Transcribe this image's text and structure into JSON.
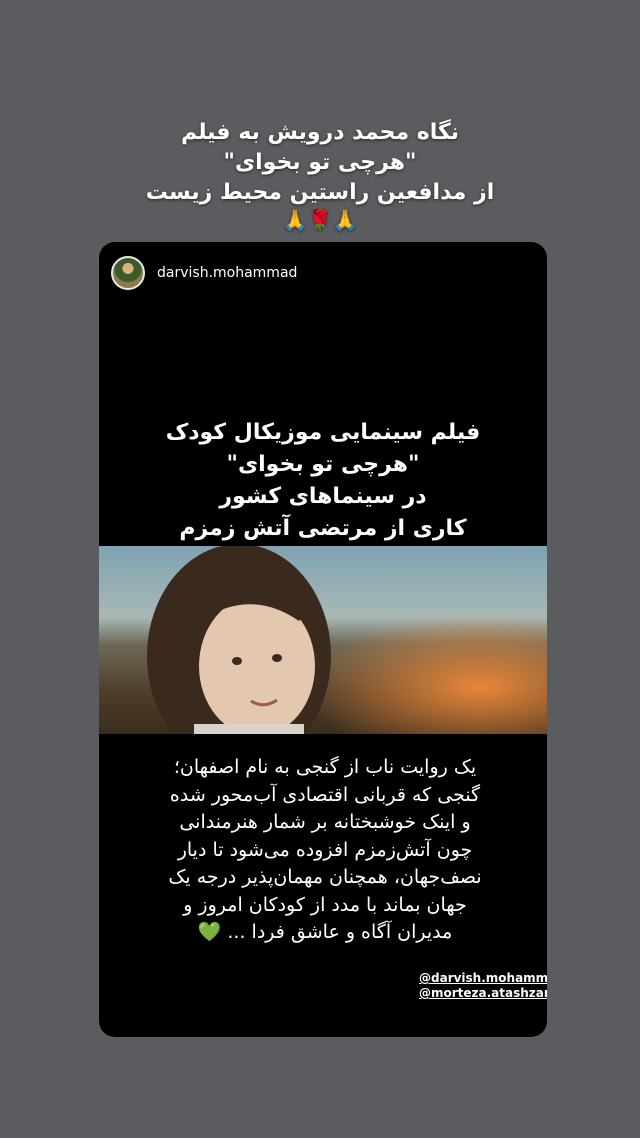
{
  "caption": {
    "lines": [
      "نگاه محمد درویش  به فیلم",
      "\"هرچی تو بخوای\"",
      "از مدافعین راستین محیط زیست"
    ],
    "emoji": "🙏🌹🙏"
  },
  "post": {
    "username": "darvish.mohammad",
    "title_lines": [
      "فیلم سینمایی موزیکال کودک",
      "\"هرچی تو بخوای\"",
      "در سینماهای کشور",
      "کاری از مرتضی آتش زمزم"
    ],
    "body_lines": [
      "یک روایت ناب از گنجی به نام اصفهان؛",
      "گنجی که قربانی اقتصادی آب‌محور شده",
      "و اینک خوشبختانه بر شمار هنرمندانی",
      "چون آتش‌زمزم افزوده می‌شود تا دیار",
      "نصف‌جهان، همچنان مهمان‌پذیر درجه یک",
      "جهان بماند با مدد از کودکان امروز و",
      "مدیران آگاه و عاشق فردا ..."
    ],
    "heart_emoji": "💚",
    "mentions": [
      "@darvish.mohammad",
      "@morteza.atashzamzam"
    ]
  }
}
